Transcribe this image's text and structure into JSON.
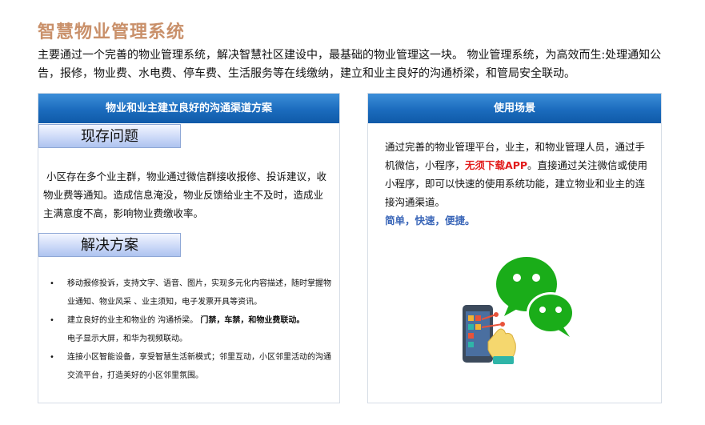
{
  "page": {
    "title": "智慧物业管理系统",
    "intro": "主要通过一个完善的物业管理系统，解决智慧社区建设中，最基础的物业管理这一块。 物业管理系统，为高效而生:处理通知公告，报修，物业费、水电费、停车费、生活服务等在线缴纳，建立和业主良好的沟通桥梁，和管局安全联动。"
  },
  "left_card": {
    "header": "物业和业主建立良好的沟通渠道方案",
    "problem_tag": "现存问题",
    "problem_text": "小区存在多个业主群，物业通过微信群接收报修、投诉建议，收物业费等通知。造成信息淹没，物业反馈给业主不及时，造成业主满意度不高，影响物业费缴收率。",
    "solution_tag": "解决方案",
    "solutions": [
      {
        "text": "移动报修投诉，支持文字、语音、图片，实现多元化内容描述，随时掌握物业通知、物业风采 、业主须知，电子发票开具等资讯。",
        "bold": ""
      },
      {
        "text": "建立良好的业主和物业的 沟通桥梁。",
        "bold": "门禁，车禁，和物业费联动。",
        "tail": "电子显示大屏，和华为视频联动。"
      },
      {
        "text": "连接小区智能设备，享受智慧生活新模式；邻里互动，小区邻里活动的沟通交流平台，打造美好的小区邻里氛围。",
        "bold": ""
      }
    ]
  },
  "right_card": {
    "header": "使用场景",
    "text_before": "通过完善的物业管理平台，业主，和物业管理人员，通过手机微信，小程序，",
    "highlight": "无须下载APP",
    "text_after": "。直接通过关注微信或使用小程序，即可以快速的使用系统功能，建立物业和业主的连接沟通渠道。",
    "slogan": "简单，快速，便捷。",
    "illustration_icon": "wechat-phone-icon"
  },
  "colors": {
    "title": "#c9906a",
    "header_blue": "#1b6bbd",
    "highlight_red": "#e21b1b",
    "slogan_blue": "#3a66b8",
    "wechat_green": "#1aad19"
  }
}
